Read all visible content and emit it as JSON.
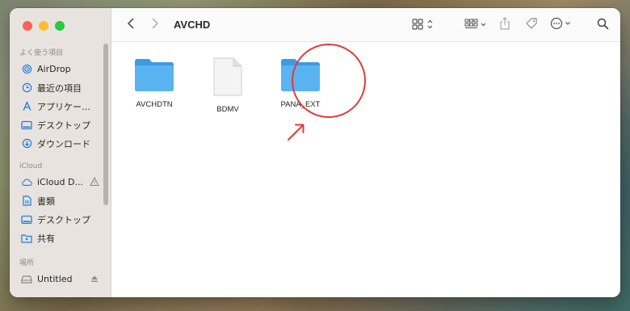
{
  "window": {
    "title": "AVCHD"
  },
  "sidebar": {
    "sections": [
      {
        "title": "よく使う項目",
        "items": [
          {
            "label": "AirDrop",
            "icon": "airdrop-icon"
          },
          {
            "label": "最近の項目",
            "icon": "clock-icon"
          },
          {
            "label": "アプリケー…",
            "icon": "applications-icon"
          },
          {
            "label": "デスクトップ",
            "icon": "desktop-icon"
          },
          {
            "label": "ダウンロード",
            "icon": "download-icon"
          }
        ]
      },
      {
        "title": "iCloud",
        "items": [
          {
            "label": "iCloud D...",
            "icon": "icloud-icon",
            "trail": "warning-icon"
          },
          {
            "label": "書類",
            "icon": "document-icon"
          },
          {
            "label": "デスクトップ",
            "icon": "desktop-icon"
          },
          {
            "label": "共有",
            "icon": "shared-folder-icon"
          }
        ]
      },
      {
        "title": "場所",
        "items": [
          {
            "label": "Untitled",
            "icon": "drive-icon",
            "trail": "eject-icon"
          }
        ]
      }
    ]
  },
  "files": [
    {
      "name": "AVCHDTN",
      "kind": "folder"
    },
    {
      "name": "BDMV",
      "kind": "document"
    },
    {
      "name": "PANA_EXT",
      "kind": "folder"
    }
  ],
  "colors": {
    "folder": "#5ab4ef",
    "annotation": "#e03a3a",
    "sidebar_icon": "#1a7ce0"
  }
}
